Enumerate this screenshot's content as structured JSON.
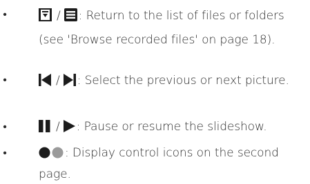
{
  "items": [
    {
      "icon_names": [
        "browse-list-icon",
        "file-list-icon"
      ],
      "separator": "/",
      "text": ": Return to the list of files or folders (see 'Browse recorded files' on page 18)."
    },
    {
      "icon_names": [
        "previous-icon",
        "next-icon"
      ],
      "separator": "/",
      "text": ": Select the previous or next picture."
    },
    {
      "icon_names": [
        "pause-icon",
        "play-icon"
      ],
      "separator": "/",
      "text": ": Pause or resume the slideshow."
    },
    {
      "icon_names": [
        "dot-black-icon",
        "dot-grey-icon"
      ],
      "separator": "",
      "text": ": Display control icons on the second page."
    }
  ],
  "bullet": "•",
  "colors": {
    "text": "#2b2b2b",
    "icon": "#1c1c1c",
    "grey_dot": "#9a9a9a"
  }
}
